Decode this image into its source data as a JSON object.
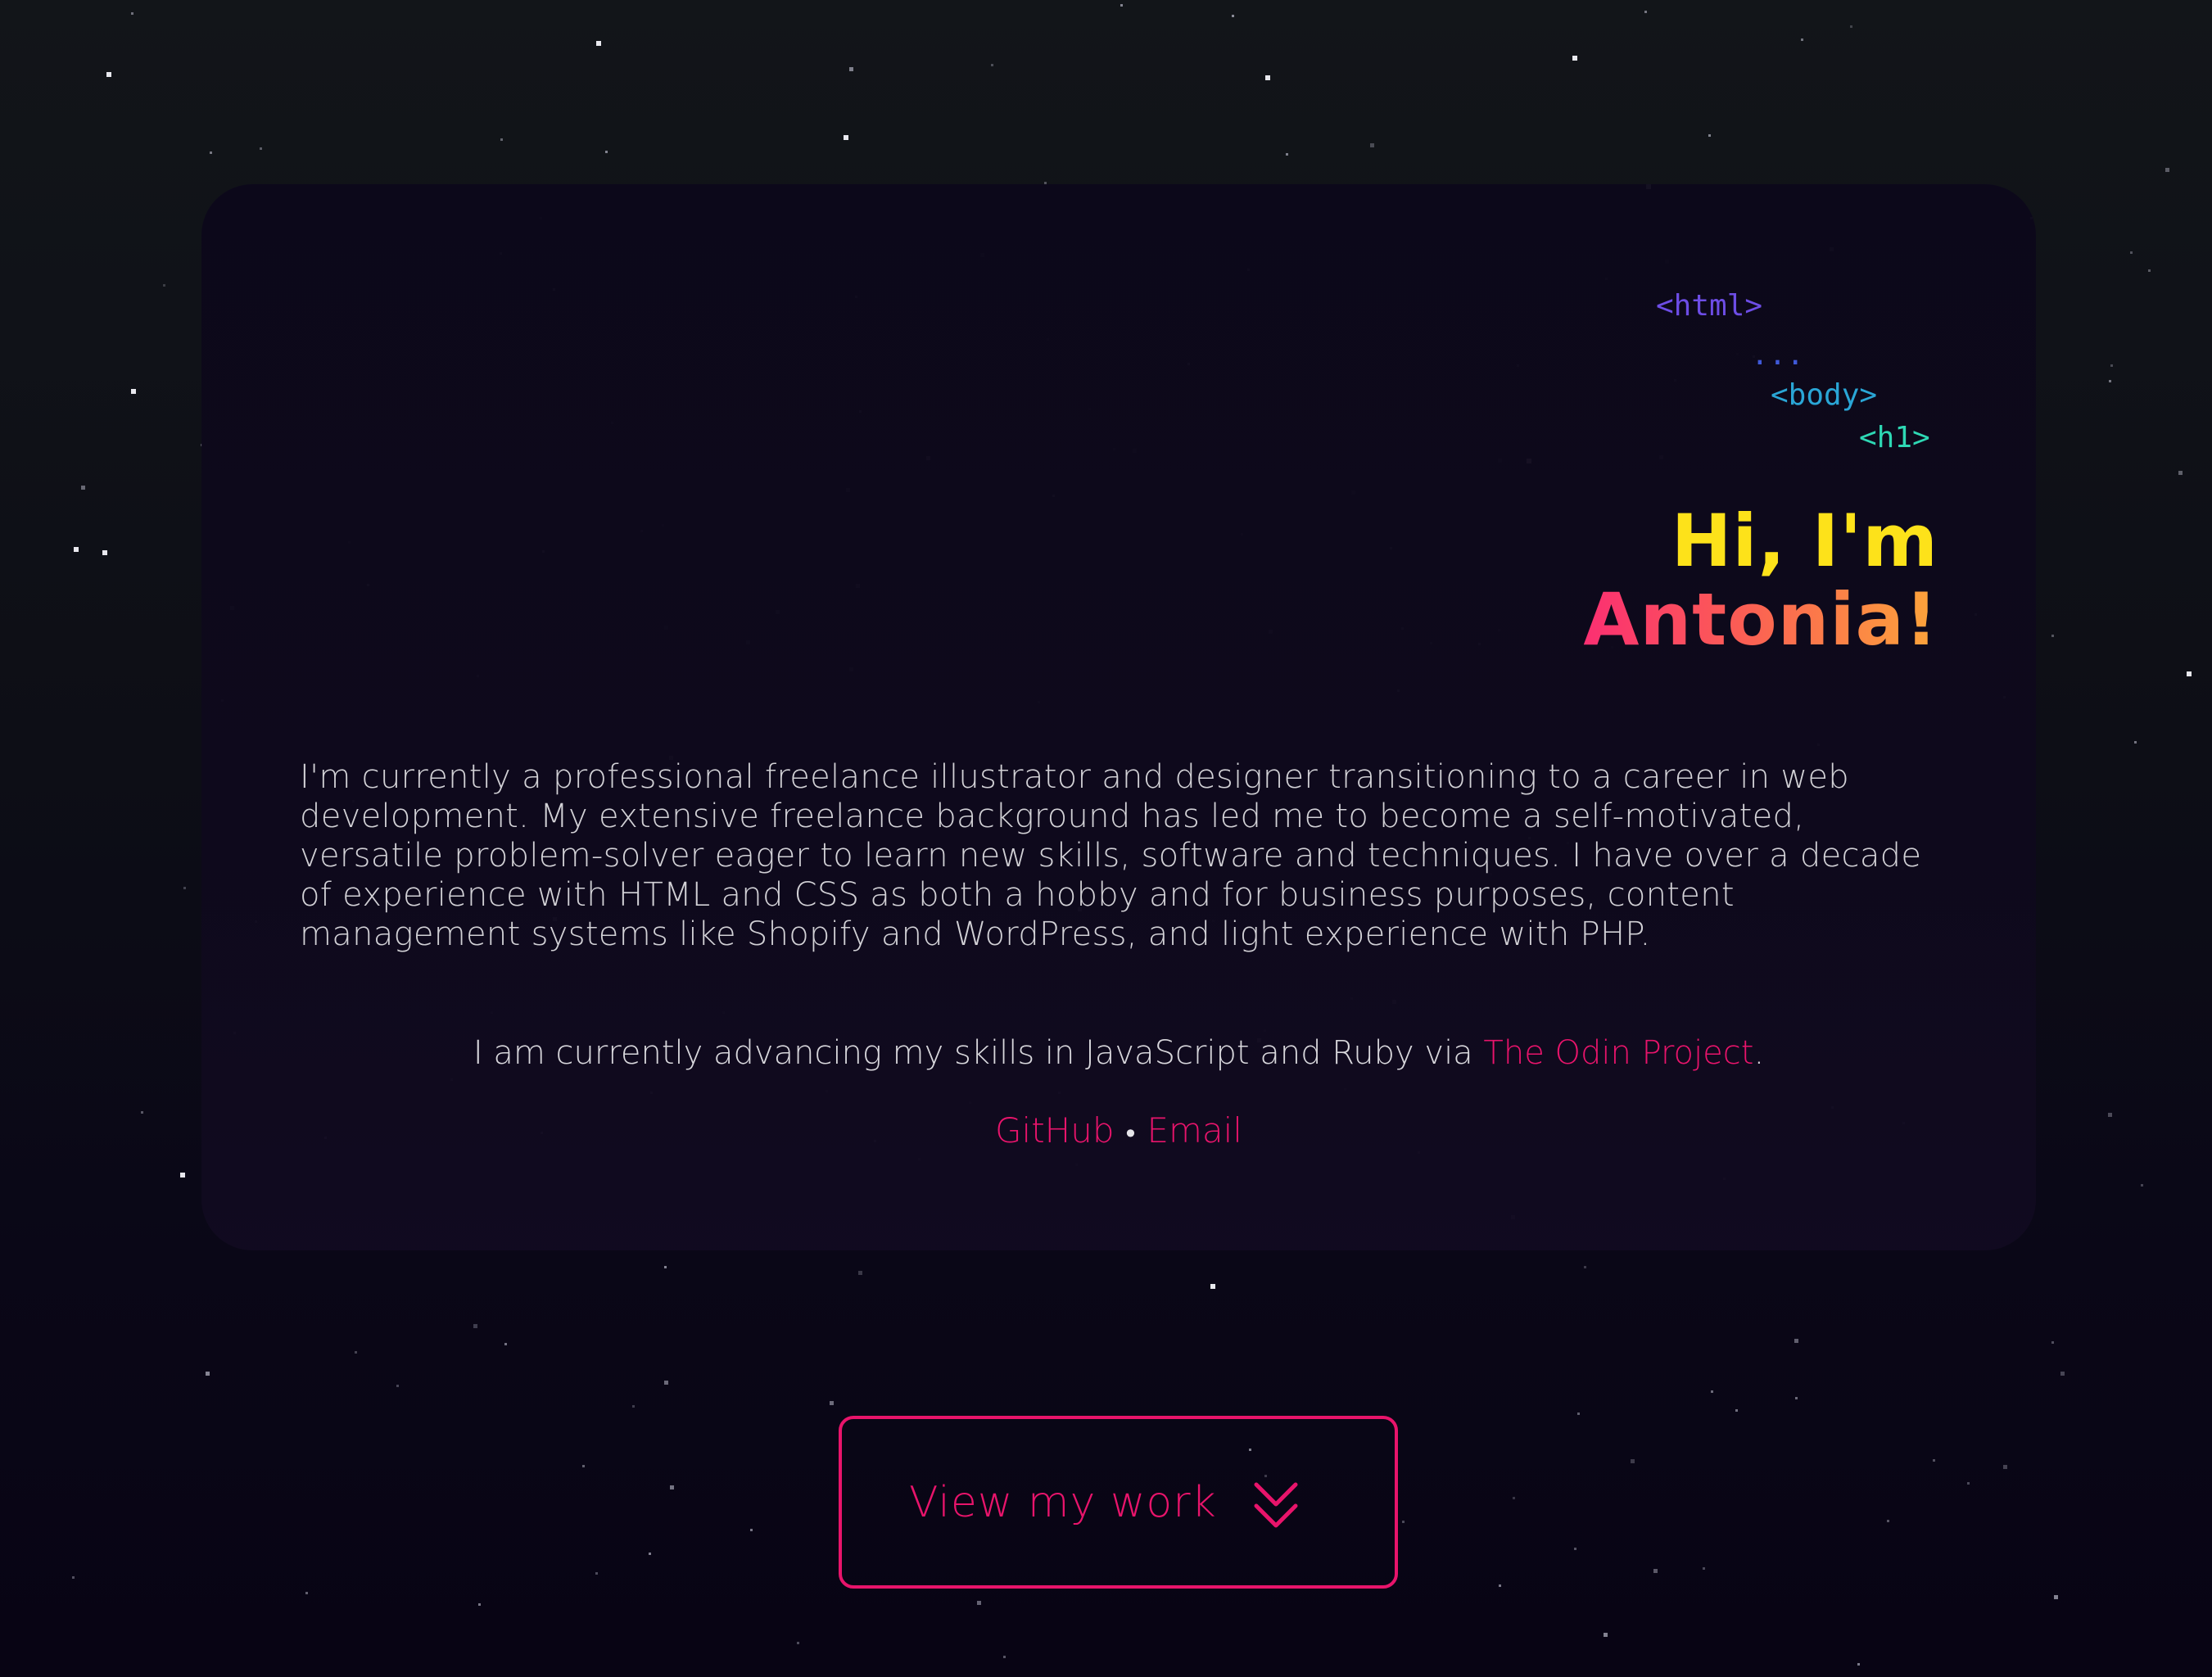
{
  "code_tags": {
    "html": "<html>",
    "dots": "...",
    "body": "<body>",
    "h1": "<h1>"
  },
  "hero": {
    "line1": "Hi, I'm",
    "line2": "Antonia!"
  },
  "bio": "I'm currently a professional freelance illustrator and designer transitioning to a career in web development. My extensive freelance background has led me to become a self-motivated, versatile problem-solver eager to learn new skills, software and techniques. I have over a decade of experience with HTML and CSS as both a hobby and for business purposes, content management systems like Shopify and WordPress, and light experience with PHP.",
  "odin": {
    "prefix": "I am currently advancing my skills in JavaScript and Ruby via ",
    "link": "The Odin Project",
    "suffix": "."
  },
  "links": {
    "github": "GitHub",
    "separator": "•",
    "email": "Email"
  },
  "cta": {
    "label": "View my work",
    "icon": "chevron-double-down-icon"
  },
  "colors": {
    "accent_pink": "#e8146b",
    "greeting_yellow": "#fde21a",
    "gradient_start": "#fb2f72",
    "gradient_end": "#fca53a",
    "tag_html": "#6d4de6",
    "tag_body": "#2aa6d6",
    "tag_h1": "#2ed8b4"
  }
}
